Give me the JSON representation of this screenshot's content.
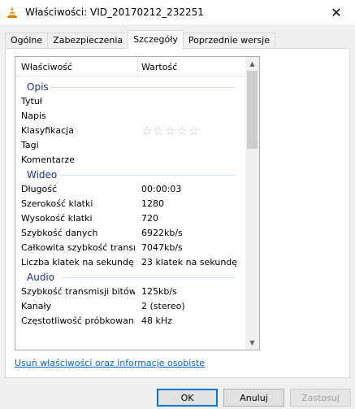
{
  "window": {
    "title": "Właściwości: VID_20170212_232251",
    "close_glyph": "✕"
  },
  "tabs": [
    {
      "label": "Ogólne",
      "active": false
    },
    {
      "label": "Zabezpieczenia",
      "active": false
    },
    {
      "label": "Szczegóły",
      "active": true
    },
    {
      "label": "Poprzednie wersje",
      "active": false
    }
  ],
  "list": {
    "col_property": "Właściwość",
    "col_value": "Wartość",
    "groups": [
      {
        "name": "Opis",
        "rows": [
          {
            "key": "Tytuł",
            "value": ""
          },
          {
            "key": "Napis",
            "value": ""
          },
          {
            "key": "Klasyfikacja",
            "value": "",
            "rating": 0
          },
          {
            "key": "Tagi",
            "value": ""
          },
          {
            "key": "Komentarze",
            "value": ""
          }
        ]
      },
      {
        "name": "Wideo",
        "rows": [
          {
            "key": "Długość",
            "value": "00:00:03"
          },
          {
            "key": "Szerokość klatki",
            "value": "1280"
          },
          {
            "key": "Wysokość klatki",
            "value": "720"
          },
          {
            "key": "Szybkość danych",
            "value": "6922kb/s"
          },
          {
            "key": "Całkowita szybkość transmi...",
            "value": "7047kb/s"
          },
          {
            "key": "Liczba klatek na sekundę",
            "value": "23 klatek na sekundę"
          }
        ]
      },
      {
        "name": "Audio",
        "rows": [
          {
            "key": "Szybkość transmisji bitów",
            "value": "125kb/s"
          },
          {
            "key": "Kanały",
            "value": "2 (stereo)"
          },
          {
            "key": "Częstotliwość próbkowania ...",
            "value": "48 kHz"
          }
        ]
      }
    ],
    "rating_glyphs": "☆☆☆☆☆"
  },
  "remove_link": "Usuń właściwości oraz informacje osobiste",
  "buttons": {
    "ok": "OK",
    "cancel": "Anuluj",
    "apply": "Zastosuj"
  },
  "colors": {
    "group_label": "#1e3287",
    "link": "#0066cc",
    "ok_border": "#0078d7"
  }
}
